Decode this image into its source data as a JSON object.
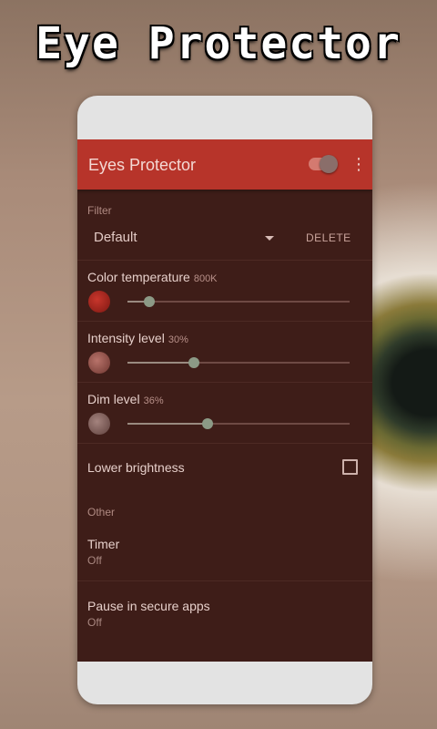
{
  "banner": {
    "title": "Eye Protector"
  },
  "appbar": {
    "title": "Eyes Protector",
    "toggle_on": true,
    "more_icon": "more-vert-icon"
  },
  "filter": {
    "header": "Filter",
    "selected": "Default",
    "delete_label": "DELETE"
  },
  "settings": {
    "color_temperature": {
      "label": "Color temperature",
      "value": "800K",
      "level": 0.1
    },
    "intensity": {
      "label": "Intensity level",
      "value": "30%",
      "level": 0.3
    },
    "dim": {
      "label": "Dim level",
      "value": "36%",
      "level": 0.36
    },
    "lower_brightness": {
      "label": "Lower brightness",
      "checked": false
    }
  },
  "other": {
    "header": "Other",
    "timer": {
      "label": "Timer",
      "value": "Off"
    },
    "pause": {
      "label": "Pause in secure apps",
      "value": "Off"
    }
  },
  "colors": {
    "appbar": "#b7342a",
    "screen_bg": "#3e1d18",
    "moon_1": "#a3231b",
    "moon_2": "#9b5a52",
    "moon_3": "#8a6561"
  }
}
